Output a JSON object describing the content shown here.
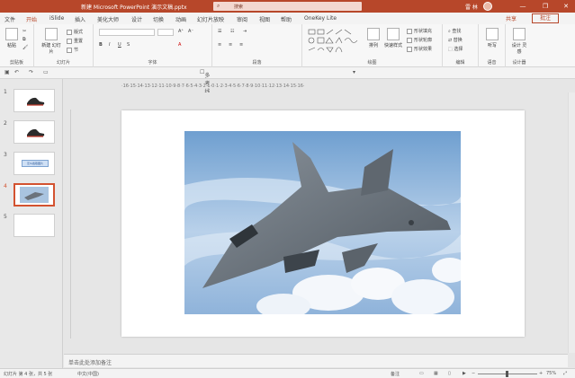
{
  "window": {
    "title": "新建 Microsoft PowerPoint 演示文稿.pptx",
    "search_placeholder": "搜索",
    "user": "雷 林",
    "minimize": "—",
    "restore": "❐",
    "close": "✕"
  },
  "tabs": [
    "文件",
    "开始",
    "iSlide",
    "插入",
    "美化大师",
    "设计",
    "切换",
    "动画",
    "幻灯片放映",
    "审阅",
    "视图",
    "帮助",
    "OneKey Lite"
  ],
  "active_tab": "开始",
  "share_label": "共享",
  "comment_label": "批注",
  "ribbon": {
    "groups": [
      "剪贴板",
      "幻灯片",
      "字体",
      "段落",
      "绘图",
      "编辑",
      "语音",
      "设计器"
    ],
    "paste": "粘贴",
    "new_slide": "新建\n幻灯片",
    "layout": "版式",
    "reset": "重置",
    "section": "节",
    "arrange": "排列",
    "quick_styles": "快速样式",
    "shape_fill": "形状填充",
    "shape_outline": "形状轮廓",
    "shape_effect": "形状效果",
    "find": "查找",
    "replace": "替换",
    "select": "选择",
    "dictate": "听写",
    "design_ideas": "设计\n灵感",
    "qat_label": "多考线"
  },
  "slides": [
    {
      "num": "1"
    },
    {
      "num": "2"
    },
    {
      "num": "3",
      "caption": "怎么截取图片"
    },
    {
      "num": "4"
    },
    {
      "num": "5"
    }
  ],
  "active_slide": 4,
  "ruler_text": "·16·15·14·13·12·11·10·9·8·7·6·5·4·3·2·1·0·1·2·3·4·5·6·7·8·9·10·11·12·13·14·15·16·",
  "notes_placeholder": "单击此处添加备注",
  "status": {
    "slide_info": "幻灯片 第 4 张，共 5 张",
    "language": "中文(中国)",
    "notes_btn": "备注",
    "zoom": "75%"
  },
  "colors": {
    "accent": "#b7472a",
    "thumb_active_border": "#d35230"
  }
}
